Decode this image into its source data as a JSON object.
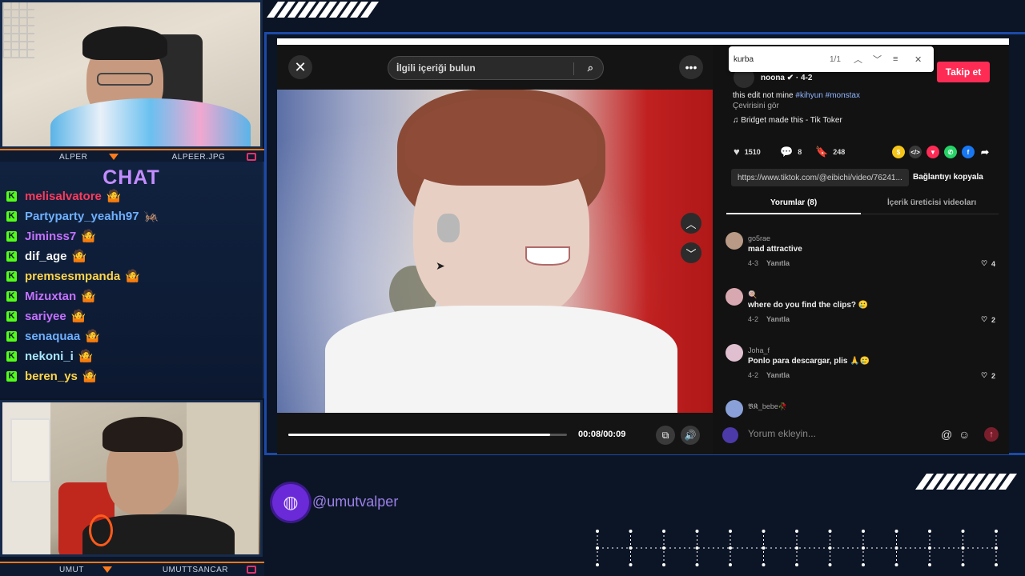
{
  "stream": {
    "cam_top": {
      "left_name": "ALPER",
      "right_name": "ALPEER.JPG"
    },
    "cam_bottom": {
      "left_name": "UMUT",
      "right_name": "UMUTTSANCAR"
    },
    "chat": {
      "title": "CHAT",
      "messages": [
        {
          "user": "melisalvatore",
          "color": "#ff3b5c",
          "badge": "🤷"
        },
        {
          "user": "Partyparty_yeahh97",
          "color": "#6fb0ff",
          "badge": "🦗"
        },
        {
          "user": "Jiminss7",
          "color": "#c471ff",
          "badge": "🤷"
        },
        {
          "user": "dif_age",
          "color": "#f5f5f5",
          "badge": "🤷"
        },
        {
          "user": "premsesmpanda",
          "color": "#ffd54a",
          "badge": "🤷"
        },
        {
          "user": "Mizuxtan",
          "color": "#c471ff",
          "badge": "🤷"
        },
        {
          "user": "sariyee",
          "color": "#c471ff",
          "badge": "🤷"
        },
        {
          "user": "senaquaa",
          "color": "#6fb0ff",
          "badge": "🤷"
        },
        {
          "user": "nekoni_i",
          "color": "#a8e8ff",
          "badge": "🤷"
        },
        {
          "user": "beren_ys",
          "color": "#ffd54a",
          "badge": "🤷"
        }
      ]
    },
    "handle": "@umutvalper"
  },
  "tiktok": {
    "search_placeholder": "İlgili içeriği bulun",
    "find": {
      "query": "kurba",
      "count": "1/1"
    },
    "follow_label": "Takip et",
    "author_line": "noona ✔ · 4-2",
    "caption": "this edit not mine",
    "hashtags": "#kihyun #monstax",
    "translate": "Çevirisini gör",
    "music": "Bridget made this - Tik Toker",
    "stats": {
      "likes": "1510",
      "comments": "8",
      "saves": "248"
    },
    "link": "https://www.tiktok.com/@eibichi/video/76241...",
    "copy_link": "Bağlantıyı kopyala",
    "tabs": [
      "Yorumlar (8)",
      "İçerik üreticisi videoları"
    ],
    "comments": [
      {
        "user": "go5rae",
        "text": "mad attractive",
        "date": "4-3",
        "reply": "Yanıtla",
        "likes": "4",
        "avatar": "#b89a86"
      },
      {
        "user": "🍭",
        "text": "where do you find the clips? 🥲",
        "date": "4-2",
        "reply": "Yanıtla",
        "likes": "2",
        "avatar": "#d8a8b0"
      },
      {
        "user": "Joha_f",
        "text": "Ponlo para descargar, plis 🙏🥲",
        "date": "4-2",
        "reply": "Yanıtla",
        "likes": "2",
        "avatar": "#e0c0d0"
      },
      {
        "user": "𝕭𝕶_bebe🥀",
        "text": "",
        "date": "",
        "reply": "",
        "likes": "",
        "avatar": "#8aa0d8"
      }
    ],
    "comment_placeholder": "Yorum ekleyin...",
    "timecode": "00:08/00:09",
    "progress": 0.94
  }
}
